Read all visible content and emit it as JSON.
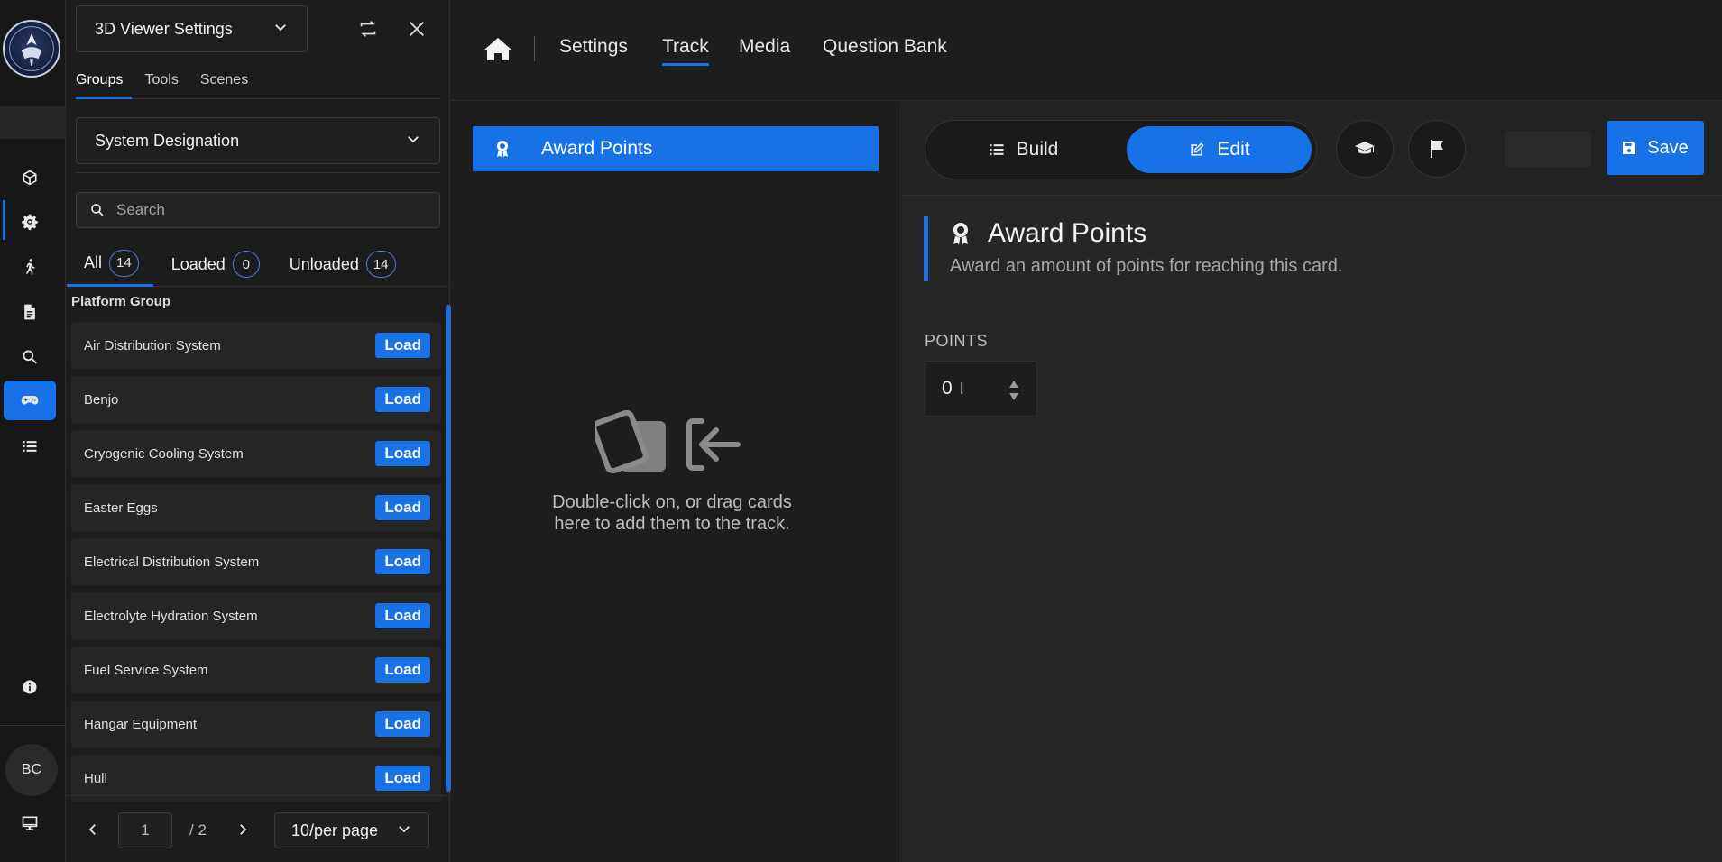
{
  "panel": {
    "title": "3D Viewer Settings",
    "tabs": [
      {
        "label": "Groups"
      },
      {
        "label": "Tools"
      },
      {
        "label": "Scenes"
      }
    ],
    "group_select": "System Designation",
    "search_placeholder": "Search",
    "filters": [
      {
        "label": "All",
        "count": "14"
      },
      {
        "label": "Loaded",
        "count": "0"
      },
      {
        "label": "Unloaded",
        "count": "14"
      }
    ],
    "group_heading": "Platform Group",
    "items": [
      {
        "name": "Air Distribution System",
        "button": "Load"
      },
      {
        "name": "Benjo",
        "button": "Load"
      },
      {
        "name": "Cryogenic Cooling System",
        "button": "Load"
      },
      {
        "name": "Easter Eggs",
        "button": "Load"
      },
      {
        "name": "Electrical Distribution System",
        "button": "Load"
      },
      {
        "name": "Electrolyte Hydration System",
        "button": "Load"
      },
      {
        "name": "Fuel Service System",
        "button": "Load"
      },
      {
        "name": "Hangar Equipment",
        "button": "Load"
      },
      {
        "name": "Hull",
        "button": "Load"
      }
    ],
    "pager": {
      "page": "1",
      "total": "/ 2",
      "per_page": "10/per page"
    }
  },
  "rail": {
    "avatar": "BC",
    "icons": [
      "cube-icon",
      "gear-icon",
      "walking-person-icon",
      "document-icon",
      "search-icon",
      "gamepad-icon",
      "list-icon",
      "info-icon",
      "monitor-icon"
    ],
    "active_icon": "gamepad-icon"
  },
  "topnav": {
    "items": [
      {
        "label": "Settings"
      },
      {
        "label": "Track"
      },
      {
        "label": "Media"
      },
      {
        "label": "Question Bank"
      }
    ],
    "active": "Track"
  },
  "track": {
    "card_label": "Award Points",
    "empty_text": "Double-click on, or drag cards here to add them to the track."
  },
  "editor": {
    "modes": [
      {
        "label": "Build"
      },
      {
        "label": "Edit"
      }
    ],
    "active_mode": "Edit",
    "save_label": "Save",
    "card_title": "Award Points",
    "card_description": "Award an amount of points for reaching this card.",
    "points_label": "POINTS",
    "points_value": "0"
  },
  "colors": {
    "accent": "#1672e6",
    "background": "#1e1e1e"
  }
}
